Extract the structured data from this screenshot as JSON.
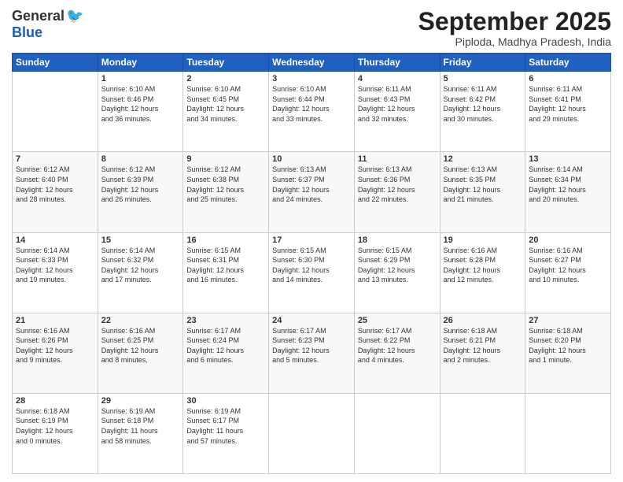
{
  "header": {
    "logo_general": "General",
    "logo_blue": "Blue",
    "month_title": "September 2025",
    "location": "Piploda, Madhya Pradesh, India"
  },
  "weekdays": [
    "Sunday",
    "Monday",
    "Tuesday",
    "Wednesday",
    "Thursday",
    "Friday",
    "Saturday"
  ],
  "weeks": [
    [
      {
        "day": "",
        "info": ""
      },
      {
        "day": "1",
        "info": "Sunrise: 6:10 AM\nSunset: 6:46 PM\nDaylight: 12 hours\nand 36 minutes."
      },
      {
        "day": "2",
        "info": "Sunrise: 6:10 AM\nSunset: 6:45 PM\nDaylight: 12 hours\nand 34 minutes."
      },
      {
        "day": "3",
        "info": "Sunrise: 6:10 AM\nSunset: 6:44 PM\nDaylight: 12 hours\nand 33 minutes."
      },
      {
        "day": "4",
        "info": "Sunrise: 6:11 AM\nSunset: 6:43 PM\nDaylight: 12 hours\nand 32 minutes."
      },
      {
        "day": "5",
        "info": "Sunrise: 6:11 AM\nSunset: 6:42 PM\nDaylight: 12 hours\nand 30 minutes."
      },
      {
        "day": "6",
        "info": "Sunrise: 6:11 AM\nSunset: 6:41 PM\nDaylight: 12 hours\nand 29 minutes."
      }
    ],
    [
      {
        "day": "7",
        "info": "Sunrise: 6:12 AM\nSunset: 6:40 PM\nDaylight: 12 hours\nand 28 minutes."
      },
      {
        "day": "8",
        "info": "Sunrise: 6:12 AM\nSunset: 6:39 PM\nDaylight: 12 hours\nand 26 minutes."
      },
      {
        "day": "9",
        "info": "Sunrise: 6:12 AM\nSunset: 6:38 PM\nDaylight: 12 hours\nand 25 minutes."
      },
      {
        "day": "10",
        "info": "Sunrise: 6:13 AM\nSunset: 6:37 PM\nDaylight: 12 hours\nand 24 minutes."
      },
      {
        "day": "11",
        "info": "Sunrise: 6:13 AM\nSunset: 6:36 PM\nDaylight: 12 hours\nand 22 minutes."
      },
      {
        "day": "12",
        "info": "Sunrise: 6:13 AM\nSunset: 6:35 PM\nDaylight: 12 hours\nand 21 minutes."
      },
      {
        "day": "13",
        "info": "Sunrise: 6:14 AM\nSunset: 6:34 PM\nDaylight: 12 hours\nand 20 minutes."
      }
    ],
    [
      {
        "day": "14",
        "info": "Sunrise: 6:14 AM\nSunset: 6:33 PM\nDaylight: 12 hours\nand 19 minutes."
      },
      {
        "day": "15",
        "info": "Sunrise: 6:14 AM\nSunset: 6:32 PM\nDaylight: 12 hours\nand 17 minutes."
      },
      {
        "day": "16",
        "info": "Sunrise: 6:15 AM\nSunset: 6:31 PM\nDaylight: 12 hours\nand 16 minutes."
      },
      {
        "day": "17",
        "info": "Sunrise: 6:15 AM\nSunset: 6:30 PM\nDaylight: 12 hours\nand 14 minutes."
      },
      {
        "day": "18",
        "info": "Sunrise: 6:15 AM\nSunset: 6:29 PM\nDaylight: 12 hours\nand 13 minutes."
      },
      {
        "day": "19",
        "info": "Sunrise: 6:16 AM\nSunset: 6:28 PM\nDaylight: 12 hours\nand 12 minutes."
      },
      {
        "day": "20",
        "info": "Sunrise: 6:16 AM\nSunset: 6:27 PM\nDaylight: 12 hours\nand 10 minutes."
      }
    ],
    [
      {
        "day": "21",
        "info": "Sunrise: 6:16 AM\nSunset: 6:26 PM\nDaylight: 12 hours\nand 9 minutes."
      },
      {
        "day": "22",
        "info": "Sunrise: 6:16 AM\nSunset: 6:25 PM\nDaylight: 12 hours\nand 8 minutes."
      },
      {
        "day": "23",
        "info": "Sunrise: 6:17 AM\nSunset: 6:24 PM\nDaylight: 12 hours\nand 6 minutes."
      },
      {
        "day": "24",
        "info": "Sunrise: 6:17 AM\nSunset: 6:23 PM\nDaylight: 12 hours\nand 5 minutes."
      },
      {
        "day": "25",
        "info": "Sunrise: 6:17 AM\nSunset: 6:22 PM\nDaylight: 12 hours\nand 4 minutes."
      },
      {
        "day": "26",
        "info": "Sunrise: 6:18 AM\nSunset: 6:21 PM\nDaylight: 12 hours\nand 2 minutes."
      },
      {
        "day": "27",
        "info": "Sunrise: 6:18 AM\nSunset: 6:20 PM\nDaylight: 12 hours\nand 1 minute."
      }
    ],
    [
      {
        "day": "28",
        "info": "Sunrise: 6:18 AM\nSunset: 6:19 PM\nDaylight: 12 hours\nand 0 minutes."
      },
      {
        "day": "29",
        "info": "Sunrise: 6:19 AM\nSunset: 6:18 PM\nDaylight: 11 hours\nand 58 minutes."
      },
      {
        "day": "30",
        "info": "Sunrise: 6:19 AM\nSunset: 6:17 PM\nDaylight: 11 hours\nand 57 minutes."
      },
      {
        "day": "",
        "info": ""
      },
      {
        "day": "",
        "info": ""
      },
      {
        "day": "",
        "info": ""
      },
      {
        "day": "",
        "info": ""
      }
    ]
  ]
}
